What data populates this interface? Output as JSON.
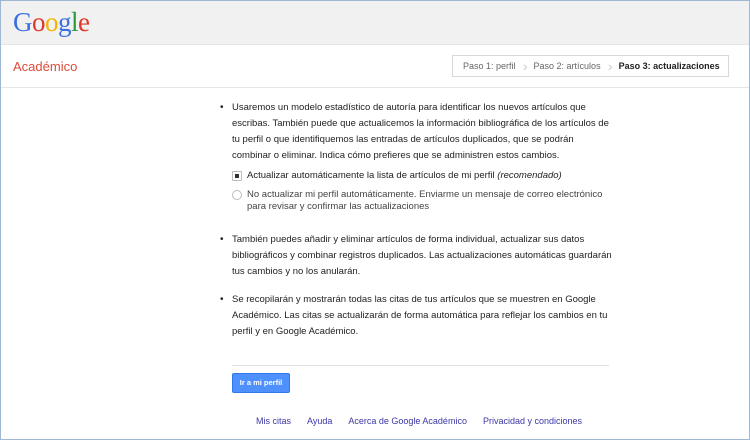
{
  "header": {
    "logo_letters": [
      "G",
      "o",
      "o",
      "g",
      "l",
      "e"
    ],
    "brand": "Académico"
  },
  "steps": [
    {
      "label": "Paso 1: perfil",
      "current": false
    },
    {
      "label": "Paso 2: artículos",
      "current": false
    },
    {
      "label": "Paso 3: actualizaciones",
      "current": true
    }
  ],
  "content": {
    "bullet1": "Usaremos un modelo estadístico de autoría para identificar los nuevos artículos que escribas. También puede que actualicemos la información bibliográfica de los artículos de tu perfil o que identifiquemos las entradas de artículos duplicados, que se podrán combinar o eliminar. Indica cómo prefieres que se administren estos cambios.",
    "option1_text": "Actualizar automáticamente la lista de artículos de mi perfil",
    "option1_note": "(recomendado)",
    "option1_checked": true,
    "option2_text": "No actualizar mi perfil automáticamente. Enviarme un mensaje de correo electrónico para revisar y confirmar las actualizaciones",
    "option2_checked": false,
    "bullet2": "También puedes añadir y eliminar artículos de forma individual, actualizar sus datos bibliográficos y combinar registros duplicados. Las actualizaciones automáticas guardarán tus cambios y no los anularán.",
    "bullet3": "Se recopilarán y mostrarán todas las citas de tus artículos que se muestren en Google Académico. Las citas se actualizarán de forma automática para reflejar los cambios en tu perfil y en Google Académico."
  },
  "actions": {
    "go_profile": "Ir a mi perfil"
  },
  "footer": {
    "links": [
      "Mis citas",
      "Ayuda",
      "Acerca de Google Académico",
      "Privacidad y condiciones"
    ]
  },
  "colors": {
    "brand": "#dd4b39",
    "button": "#4d90fe",
    "link": "#3b37a6"
  }
}
